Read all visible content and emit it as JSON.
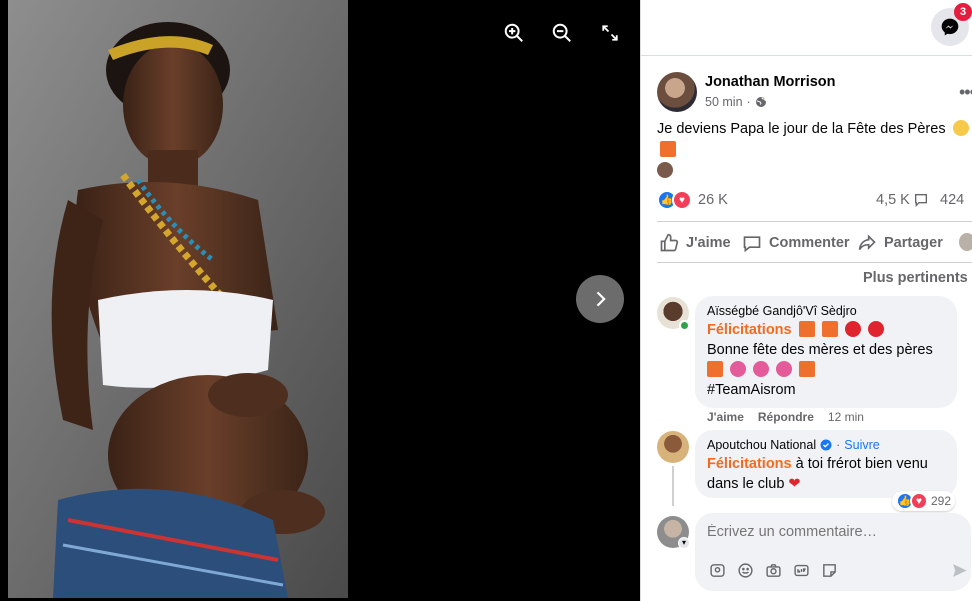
{
  "messenger": {
    "badge_count": "3"
  },
  "post": {
    "author": "Jonathan Morrison",
    "time": "50 min",
    "meta_separator": "·",
    "text": "Je deviens Papa le jour de la Fête des Pères",
    "reaction_count": "26 K",
    "comment_count": "4,5 K",
    "share_count": "424"
  },
  "actions": {
    "like": "J'aime",
    "comment": "Commenter",
    "share": "Partager"
  },
  "sort_label": "Plus pertinents",
  "comments": [
    {
      "author": "Aïsségbé Gandjô'Vî Sèdjro",
      "highlight": "Félicitations",
      "line2": "Bonne fête des mères et des pères",
      "hashtag": "#TeamAisrom",
      "like": "J'aime",
      "reply": "Répondre",
      "time": "12 min"
    },
    {
      "author": "Apoutchou National",
      "follow": "Suivre",
      "separator": "·",
      "highlight": "Félicitations",
      "rest": " à toi frérot bien venu dans le club",
      "reaction_count": "292"
    }
  ],
  "composer": {
    "placeholder": "Écrivez un commentaire…"
  },
  "colors": {
    "accent": "#1877f2",
    "highlight": "#f36b21",
    "love": "#f33e58",
    "badge": "#e41e3f"
  }
}
